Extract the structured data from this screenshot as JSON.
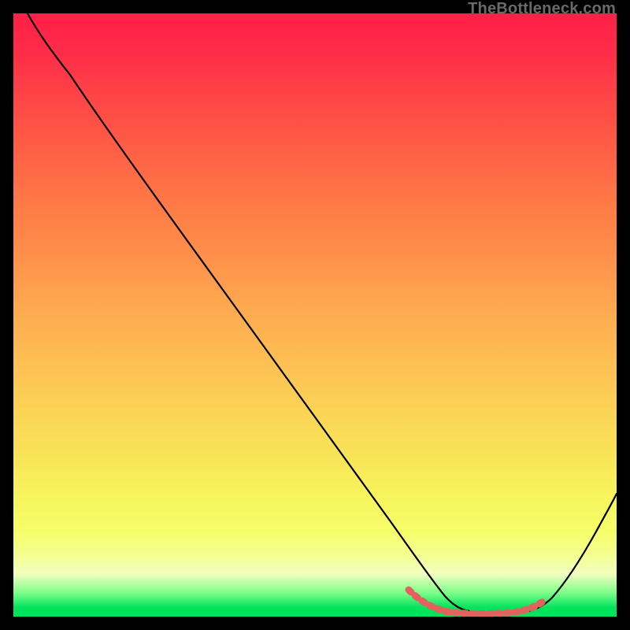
{
  "watermark": "TheBottleneck.com",
  "chart_data": {
    "type": "line",
    "title": "",
    "xlabel": "",
    "ylabel": "",
    "xlim": [
      0,
      100
    ],
    "ylim": [
      0,
      100
    ],
    "grid": false,
    "legend": false,
    "background": "rainbow_vertical_gradient",
    "series": [
      {
        "name": "bottleneck-curve",
        "x": [
          3,
          6,
          10,
          15,
          20,
          25,
          30,
          35,
          40,
          45,
          50,
          55,
          60,
          64,
          68,
          71,
          73,
          75,
          77,
          80,
          83,
          86,
          89,
          92,
          95,
          98,
          100
        ],
        "values": [
          100,
          97,
          93,
          88,
          82,
          76,
          70,
          64,
          57,
          51,
          44,
          38,
          31,
          24,
          17,
          11,
          7,
          4,
          2,
          1,
          1,
          1,
          2,
          5,
          10,
          17,
          22
        ]
      }
    ],
    "highlight_range_x": [
      65,
      88
    ],
    "annotations": []
  }
}
